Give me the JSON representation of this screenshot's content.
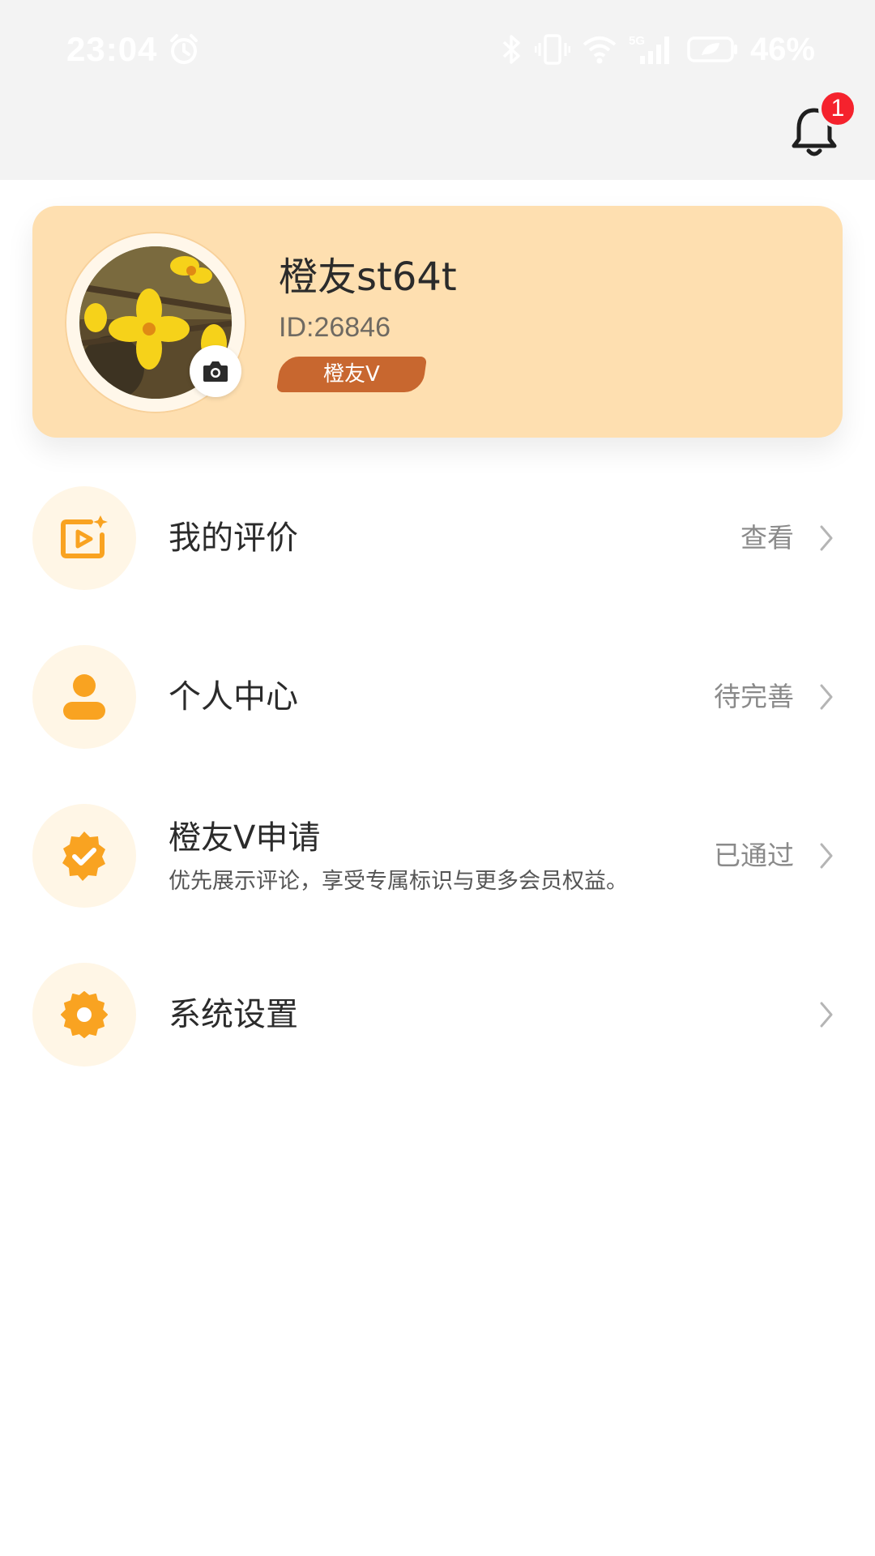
{
  "status_bar": {
    "time": "23:04",
    "battery": "46%",
    "network": "5G"
  },
  "header": {
    "notification_count": "1"
  },
  "profile": {
    "nickname": "橙友st64t",
    "user_id": "ID:26846",
    "badge": "橙友V"
  },
  "menu": {
    "items": [
      {
        "title": "我的评价",
        "status": "查看"
      },
      {
        "title": "个人中心",
        "status": "待完善"
      },
      {
        "title": "橙友V申请",
        "subtitle": "优先展示评论，享受专属标识与更多会员权益。",
        "status": "已通过"
      },
      {
        "title": "系统设置",
        "status": ""
      }
    ]
  },
  "colors": {
    "accent": "#f9a321",
    "card": "#fedfb0",
    "badge": "#c8672f",
    "notify": "#f5222d"
  }
}
